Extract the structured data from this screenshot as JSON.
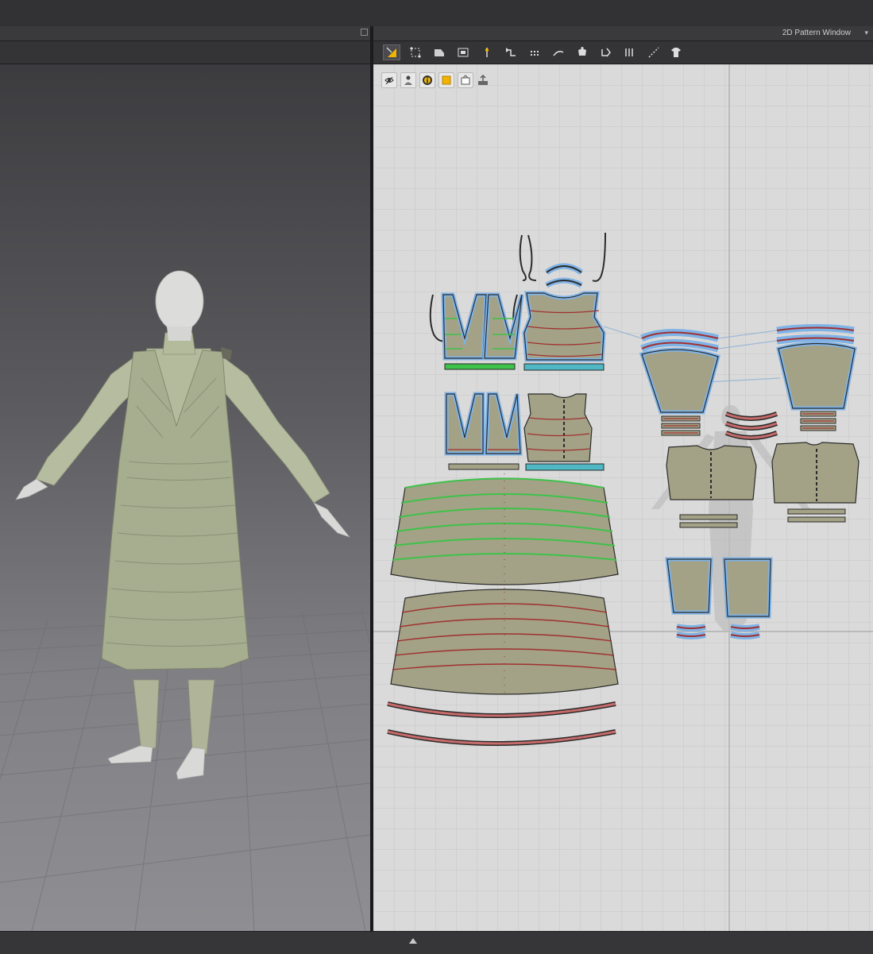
{
  "app": {
    "pattern_window_title": "2D Pattern Window",
    "pattern_window_menu": "▾"
  },
  "toolbar_2d": {
    "tools": [
      {
        "name": "transform-pattern-tool-icon",
        "active": true
      },
      {
        "name": "edit-point-tool-icon",
        "active": false
      },
      {
        "name": "rectangle-tool-icon",
        "active": false
      },
      {
        "name": "internal-rectangle-tool-icon",
        "active": false
      },
      {
        "name": "edit-sewing-tool-icon",
        "active": false
      },
      {
        "name": "segment-sewing-tool-icon",
        "active": false
      },
      {
        "name": "grid-tool-icon",
        "active": false
      },
      {
        "name": "pin-tool-icon",
        "active": false
      },
      {
        "name": "arrangement-tool-icon",
        "active": false
      },
      {
        "name": "fold-tool-icon",
        "active": false
      },
      {
        "name": "pleats-tool-icon",
        "active": false
      },
      {
        "name": "topstitch-tool-icon",
        "active": false
      },
      {
        "name": "avatar-garment-icon",
        "active": false
      }
    ]
  },
  "view_controls_2d": {
    "buttons": [
      {
        "name": "show-pattern-icon"
      },
      {
        "name": "show-avatar-icon"
      },
      {
        "name": "info-icon"
      },
      {
        "name": "texture-view-icon"
      },
      {
        "name": "fabric-view-icon"
      },
      {
        "name": "export-icon"
      }
    ]
  },
  "colors": {
    "fabric": "#a3a286",
    "pattern_outline": "#2a2a2a",
    "selected_outline": "#7fb3e6",
    "seam_red": "#a03030",
    "seam_green": "#3ec24a",
    "grid_bg": "#dadada",
    "garment_3d": "#aeb49a"
  },
  "status": {
    "collapse_arrow": "up-arrow-icon"
  }
}
